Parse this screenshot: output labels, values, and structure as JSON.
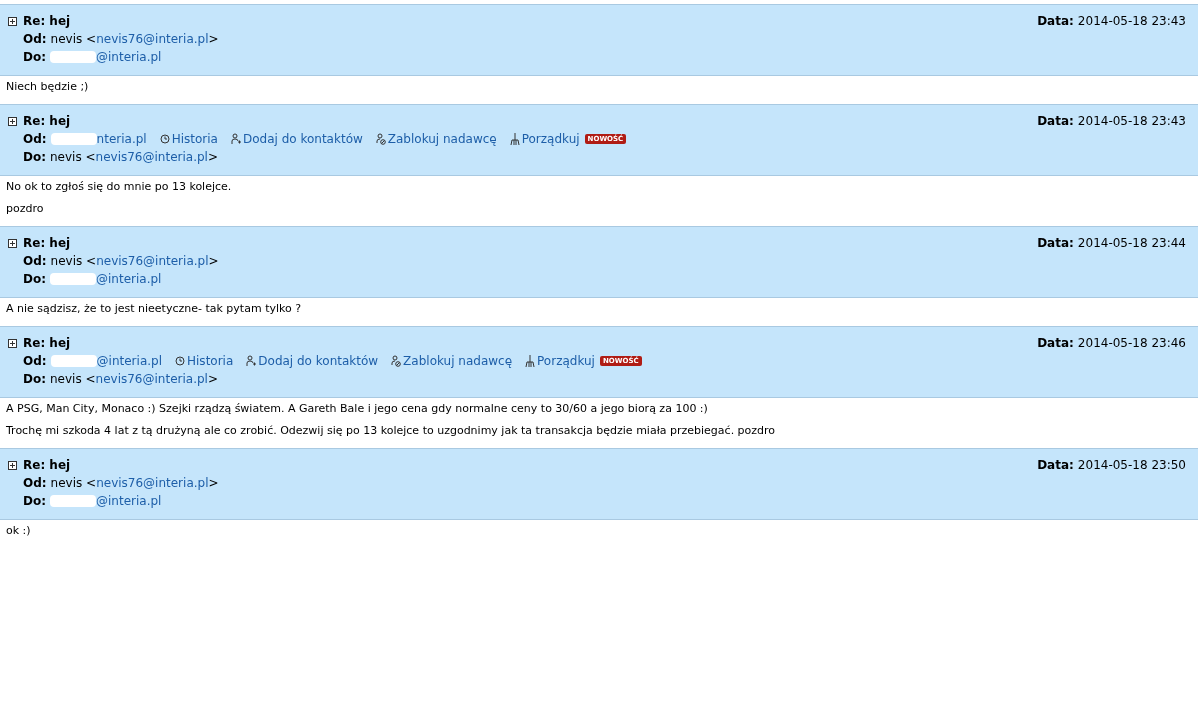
{
  "messages": [
    {
      "subject": "Re: hej",
      "date_label": "Data:",
      "date": "2014-05-18 23:43",
      "from": {
        "label": "Od:",
        "prefix": "nevis <",
        "email": "nevis76@interia.pl",
        "suffix": ">"
      },
      "to": {
        "label": "Do:",
        "email": "@interia.pl",
        "redacted": true
      },
      "body": [
        "Niech będzie ;)"
      ]
    },
    {
      "subject": "Re: hej",
      "date_label": "Data:",
      "date": "2014-05-18 23:43",
      "from": {
        "label": "Od:",
        "email": "nteria.pl",
        "redacted": true
      },
      "to": {
        "label": "Do:",
        "prefix": "nevis <",
        "email": "nevis76@interia.pl",
        "suffix": ">"
      },
      "actions": [
        {
          "kind": "history",
          "label": "Historia"
        },
        {
          "kind": "add",
          "label": "Dodaj do kontaktów"
        },
        {
          "kind": "block",
          "label": "Zablokuj nadawcę"
        },
        {
          "kind": "clean",
          "label": "Porządkuj",
          "badge": "NOWOŚĆ"
        }
      ],
      "body": [
        "No ok to zgłoś się do mnie po 13 kolejce.",
        "pozdro"
      ]
    },
    {
      "subject": "Re: hej",
      "date_label": "Data:",
      "date": "2014-05-18 23:44",
      "from": {
        "label": "Od:",
        "prefix": "nevis <",
        "email": "nevis76@interia.pl",
        "suffix": ">"
      },
      "to": {
        "label": "Do:",
        "email": "@interia.pl",
        "redacted": true
      },
      "body": [
        "A nie sądzisz, że to jest nieetyczne- tak pytam tylko ?"
      ]
    },
    {
      "subject": "Re: hej",
      "date_label": "Data:",
      "date": "2014-05-18 23:46",
      "from": {
        "label": "Od:",
        "email": "@interia.pl",
        "redacted": true
      },
      "to": {
        "label": "Do:",
        "prefix": "nevis <",
        "email": "nevis76@interia.pl",
        "suffix": ">"
      },
      "actions": [
        {
          "kind": "history",
          "label": "Historia"
        },
        {
          "kind": "add",
          "label": "Dodaj do kontaktów"
        },
        {
          "kind": "block",
          "label": "Zablokuj nadawcę"
        },
        {
          "kind": "clean",
          "label": "Porządkuj",
          "badge": "NOWOŚĆ"
        }
      ],
      "body": [
        "A PSG, Man City, Monaco :) Szejki rządzą światem. A Gareth Bale i jego cena gdy normalne ceny to 30/60 a jego biorą za 100 :)",
        "Trochę mi szkoda 4 lat z tą drużyną ale co zrobić. Odezwij się po 13 kolejce to uzgodnimy jak ta transakcja będzie miała przebiegać. pozdro"
      ]
    },
    {
      "subject": "Re: hej",
      "date_label": "Data:",
      "date": "2014-05-18 23:50",
      "from": {
        "label": "Od:",
        "prefix": "nevis <",
        "email": "nevis76@interia.pl",
        "suffix": ">"
      },
      "to": {
        "label": "Do:",
        "email": "@interia.pl",
        "redacted": true
      },
      "body": [
        "ok :)"
      ]
    }
  ]
}
